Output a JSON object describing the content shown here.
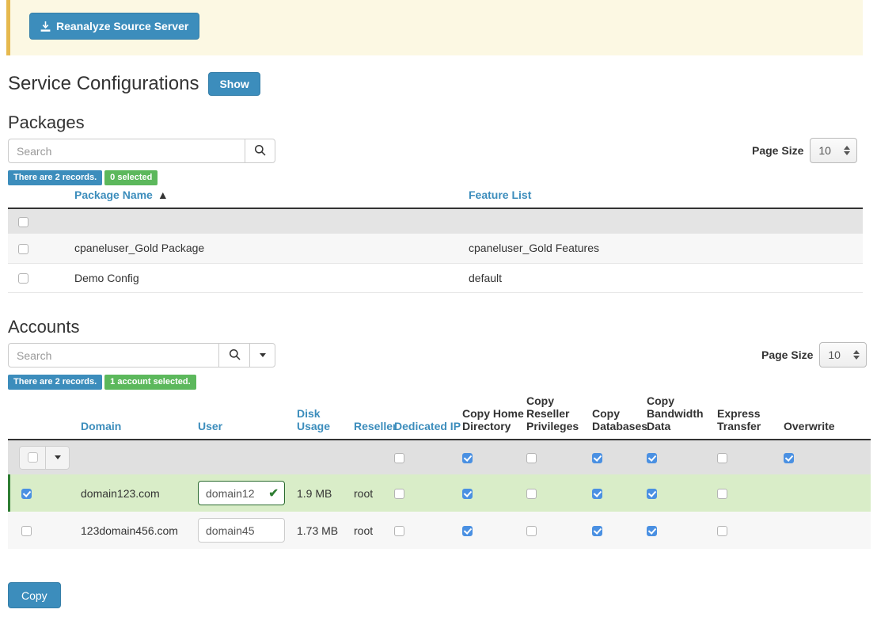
{
  "banner": {
    "reanalyze_label": "Reanalyze Source Server",
    "icon": "download-icon",
    "accent_color": "#e6b94e",
    "background_color": "#fcf8e3"
  },
  "service_configurations": {
    "title": "Service Configurations",
    "show_label": "Show"
  },
  "packages": {
    "title": "Packages",
    "search": {
      "value": "",
      "placeholder": "Search",
      "icon": "search-icon"
    },
    "badges": {
      "records": "There are 2 records.",
      "selected": "0 selected"
    },
    "page_size": {
      "label": "Page Size",
      "value": "10"
    },
    "columns": [
      "Package Name",
      "Feature List"
    ],
    "sort_column": "Package Name",
    "sort_direction": "ascending",
    "sort_icon": "▲",
    "select_all_checked": false,
    "rows": [
      {
        "selected": false,
        "package_name": "cpaneluser_Gold Package",
        "feature_list": "cpaneluser_Gold Features"
      },
      {
        "selected": false,
        "package_name": "Demo Config",
        "feature_list": "default"
      }
    ]
  },
  "accounts": {
    "title": "Accounts",
    "search": {
      "value": "",
      "placeholder": "Search",
      "icon": "search-icon",
      "caret_icon": "chevron-down-icon"
    },
    "badges": {
      "records": "There are 2 records.",
      "selected": "1 account selected."
    },
    "page_size": {
      "label": "Page Size",
      "value": "10"
    },
    "columns": [
      {
        "label": "Domain",
        "style": "link"
      },
      {
        "label": "User",
        "style": "link"
      },
      {
        "label": "Disk Usage",
        "style": "link"
      },
      {
        "label": "Reseller",
        "style": "link"
      },
      {
        "label": "Dedicated IP",
        "style": "link"
      },
      {
        "label": "Copy Home Directory",
        "style": "dark"
      },
      {
        "label": "Copy Reseller Privileges",
        "style": "dark"
      },
      {
        "label": "Copy Databases",
        "style": "dark"
      },
      {
        "label": "Copy Bandwidth Data",
        "style": "dark"
      },
      {
        "label": "Express Transfer",
        "style": "dark"
      },
      {
        "label": "Overwrite",
        "style": "dark"
      }
    ],
    "filter_row": {
      "select_all_checked": false,
      "dedicated_ip": false,
      "copy_home_directory": true,
      "copy_reseller_privileges": false,
      "copy_databases": true,
      "copy_bandwidth_data": true,
      "express_transfer": false,
      "overwrite": true
    },
    "rows": [
      {
        "selected": true,
        "domain": "domain123.com",
        "user": "domain12",
        "user_valid": true,
        "user_valid_icon": "check-icon",
        "disk_usage": "1.9 MB",
        "reseller": "root",
        "dedicated_ip": false,
        "copy_home_directory": true,
        "copy_reseller_privileges": false,
        "copy_databases": true,
        "copy_bandwidth_data": true,
        "express_transfer": false,
        "overwrite": null
      },
      {
        "selected": false,
        "domain": "123domain456.com",
        "user": "domain45",
        "user_valid": false,
        "user_valid_icon": "",
        "disk_usage": "1.73 MB",
        "reseller": "root",
        "dedicated_ip": false,
        "copy_home_directory": true,
        "copy_reseller_privileges": false,
        "copy_databases": true,
        "copy_bandwidth_data": true,
        "express_transfer": false,
        "overwrite": null
      }
    ],
    "copy_label": "Copy"
  },
  "colors": {
    "primary": "#3c8dbc",
    "success": "#5cb85c",
    "selected_row": "#d9edc8",
    "link": "#3c8dbc"
  }
}
